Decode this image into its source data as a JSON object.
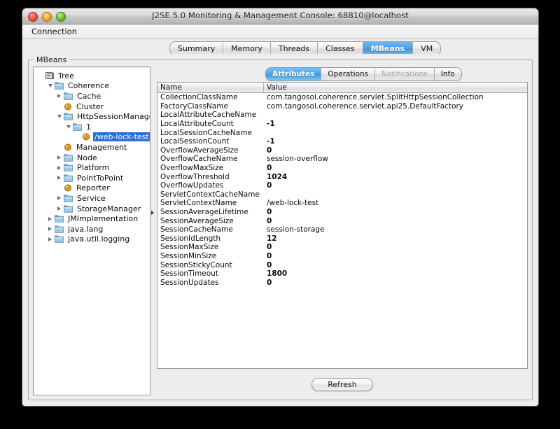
{
  "window": {
    "title": "J2SE 5.0 Monitoring & Management Console: 68810@localhost",
    "lights": {
      "close": "close-button",
      "minimize": "minimize-button",
      "maximize": "maximize-button"
    }
  },
  "menubar": {
    "items": [
      {
        "label": "Connection"
      }
    ]
  },
  "main_tabs": [
    {
      "label": "Summary",
      "selected": false
    },
    {
      "label": "Memory",
      "selected": false
    },
    {
      "label": "Threads",
      "selected": false
    },
    {
      "label": "Classes",
      "selected": false
    },
    {
      "label": "MBeans",
      "selected": true
    },
    {
      "label": "VM",
      "selected": false
    }
  ],
  "panel": {
    "legend": "MBeans"
  },
  "tree": {
    "nodes": [
      {
        "label": "Tree",
        "indent": 0,
        "twist": "none",
        "icon": "tree-root-icon",
        "selected": false
      },
      {
        "label": "Coherence",
        "indent": 1,
        "twist": "open",
        "icon": "folder-icon",
        "selected": false
      },
      {
        "label": "Cache",
        "indent": 2,
        "twist": "closed",
        "icon": "folder-icon",
        "selected": false
      },
      {
        "label": "Cluster",
        "indent": 2,
        "twist": "none",
        "icon": "mbean-icon",
        "selected": false
      },
      {
        "label": "HttpSessionManager",
        "indent": 2,
        "twist": "open",
        "icon": "folder-icon",
        "selected": false
      },
      {
        "label": "1",
        "indent": 3,
        "twist": "open",
        "icon": "folder-icon",
        "selected": false
      },
      {
        "label": "/web-lock-test",
        "indent": 4,
        "twist": "none",
        "icon": "mbean-icon",
        "selected": true
      },
      {
        "label": "Management",
        "indent": 2,
        "twist": "none",
        "icon": "mbean-icon",
        "selected": false
      },
      {
        "label": "Node",
        "indent": 2,
        "twist": "closed",
        "icon": "folder-icon",
        "selected": false
      },
      {
        "label": "Platform",
        "indent": 2,
        "twist": "closed",
        "icon": "folder-icon",
        "selected": false
      },
      {
        "label": "PointToPoint",
        "indent": 2,
        "twist": "closed",
        "icon": "folder-icon",
        "selected": false
      },
      {
        "label": "Reporter",
        "indent": 2,
        "twist": "none",
        "icon": "mbean-icon",
        "selected": false
      },
      {
        "label": "Service",
        "indent": 2,
        "twist": "closed",
        "icon": "folder-icon",
        "selected": false
      },
      {
        "label": "StorageManager",
        "indent": 2,
        "twist": "closed",
        "icon": "folder-icon",
        "selected": false
      },
      {
        "label": "JMImplementation",
        "indent": 1,
        "twist": "closed",
        "icon": "folder-icon",
        "selected": false
      },
      {
        "label": "java.lang",
        "indent": 1,
        "twist": "closed",
        "icon": "folder-icon",
        "selected": false
      },
      {
        "label": "java.util.logging",
        "indent": 1,
        "twist": "closed",
        "icon": "folder-icon",
        "selected": false
      }
    ]
  },
  "inner_tabs": [
    {
      "label": "Attributes",
      "selected": true,
      "disabled": false
    },
    {
      "label": "Operations",
      "selected": false,
      "disabled": false
    },
    {
      "label": "Notifications",
      "selected": false,
      "disabled": true
    },
    {
      "label": "Info",
      "selected": false,
      "disabled": false
    }
  ],
  "table": {
    "columns": [
      "Name",
      "Value"
    ],
    "rows": [
      {
        "name": "CollectionClassName",
        "value": "com.tangosol.coherence.servlet.SplitHttpSessionCollection",
        "numeric": false
      },
      {
        "name": "FactoryClassName",
        "value": "com.tangosol.coherence.servlet.api25.DefaultFactory",
        "numeric": false
      },
      {
        "name": "LocalAttributeCacheName",
        "value": "",
        "numeric": false
      },
      {
        "name": "LocalAttributeCount",
        "value": "-1",
        "numeric": true
      },
      {
        "name": "LocalSessionCacheName",
        "value": "",
        "numeric": false
      },
      {
        "name": "LocalSessionCount",
        "value": "-1",
        "numeric": true
      },
      {
        "name": "OverflowAverageSize",
        "value": "0",
        "numeric": true
      },
      {
        "name": "OverflowCacheName",
        "value": "session-overflow",
        "numeric": false
      },
      {
        "name": "OverflowMaxSize",
        "value": "0",
        "numeric": true
      },
      {
        "name": "OverflowThreshold",
        "value": "1024",
        "numeric": true
      },
      {
        "name": "OverflowUpdates",
        "value": "0",
        "numeric": true
      },
      {
        "name": "ServletContextCacheName",
        "value": "",
        "numeric": false
      },
      {
        "name": "ServletContextName",
        "value": "/web-lock-test",
        "numeric": false
      },
      {
        "name": "SessionAverageLifetime",
        "value": "0",
        "numeric": true
      },
      {
        "name": "SessionAverageSize",
        "value": "0",
        "numeric": true
      },
      {
        "name": "SessionCacheName",
        "value": "session-storage",
        "numeric": false
      },
      {
        "name": "SessionIdLength",
        "value": "12",
        "numeric": true
      },
      {
        "name": "SessionMaxSize",
        "value": "0",
        "numeric": true
      },
      {
        "name": "SessionMinSize",
        "value": "0",
        "numeric": true
      },
      {
        "name": "SessionStickyCount",
        "value": "0",
        "numeric": true
      },
      {
        "name": "SessionTimeout",
        "value": "1800",
        "numeric": true
      },
      {
        "name": "SessionUpdates",
        "value": "0",
        "numeric": true
      }
    ]
  },
  "actions": {
    "refresh_label": "Refresh"
  },
  "colors": {
    "selection_blue": "#2b6fd4",
    "tab_blue": "#4f9fe4",
    "folder_blue": "#86b9de",
    "mbean_orange": "#e08a22",
    "window_bg": "#ededed",
    "desktop": "#000000"
  }
}
